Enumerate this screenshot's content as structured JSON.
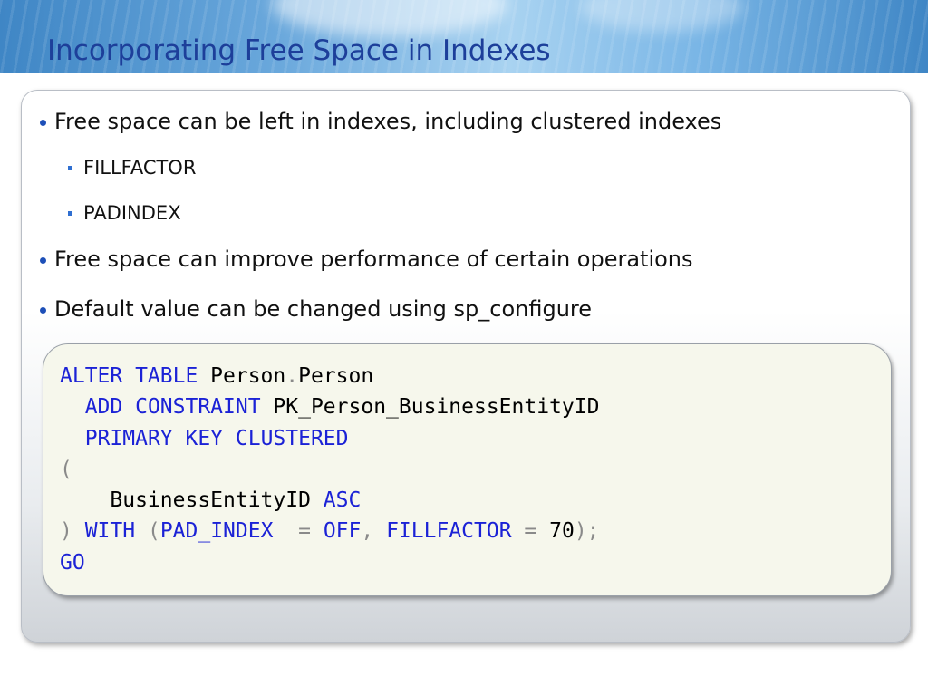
{
  "slide": {
    "title": "Incorporating Free Space in Indexes",
    "bullets": [
      {
        "text": "Free space can be left in indexes, including clustered indexes",
        "level": 1
      },
      {
        "text": "FILLFACTOR",
        "level": 2
      },
      {
        "text": "PADINDEX",
        "level": 2
      },
      {
        "text": "Free space can improve performance of certain operations",
        "level": 1
      },
      {
        "text": "Default value can be changed using sp_configure",
        "level": 1
      }
    ]
  },
  "code": {
    "lines": [
      [
        {
          "t": "ALTER TABLE ",
          "c": "kw"
        },
        {
          "t": "Person",
          "c": "pl"
        },
        {
          "t": ".",
          "c": "op"
        },
        {
          "t": "Person",
          "c": "pl"
        }
      ],
      [
        {
          "t": "  ",
          "c": "pl"
        },
        {
          "t": "ADD CONSTRAINT ",
          "c": "kw"
        },
        {
          "t": "PK_Person_BusinessEntityID",
          "c": "pl"
        }
      ],
      [
        {
          "t": "  ",
          "c": "pl"
        },
        {
          "t": "PRIMARY KEY CLUSTERED",
          "c": "kw"
        }
      ],
      [
        {
          "t": "(",
          "c": "op"
        }
      ],
      [
        {
          "t": "    ",
          "c": "pl"
        },
        {
          "t": "BusinessEntityID ",
          "c": "pl"
        },
        {
          "t": "ASC",
          "c": "kw"
        }
      ],
      [
        {
          "t": ") ",
          "c": "op"
        },
        {
          "t": "WITH ",
          "c": "kw"
        },
        {
          "t": "(",
          "c": "op"
        },
        {
          "t": "PAD_INDEX",
          "c": "kw"
        },
        {
          "t": "  = ",
          "c": "op"
        },
        {
          "t": "OFF",
          "c": "kw"
        },
        {
          "t": ", ",
          "c": "op"
        },
        {
          "t": "FILLFACTOR",
          "c": "kw"
        },
        {
          "t": " = ",
          "c": "op"
        },
        {
          "t": "70",
          "c": "pl"
        },
        {
          "t": ");",
          "c": "op"
        }
      ],
      [
        {
          "t": "GO",
          "c": "kw"
        }
      ]
    ]
  },
  "colors": {
    "title": "#1d3f9a",
    "keyword": "#1b22d6",
    "operator": "#8a8a8a",
    "bullet": "#1d4fb8"
  }
}
